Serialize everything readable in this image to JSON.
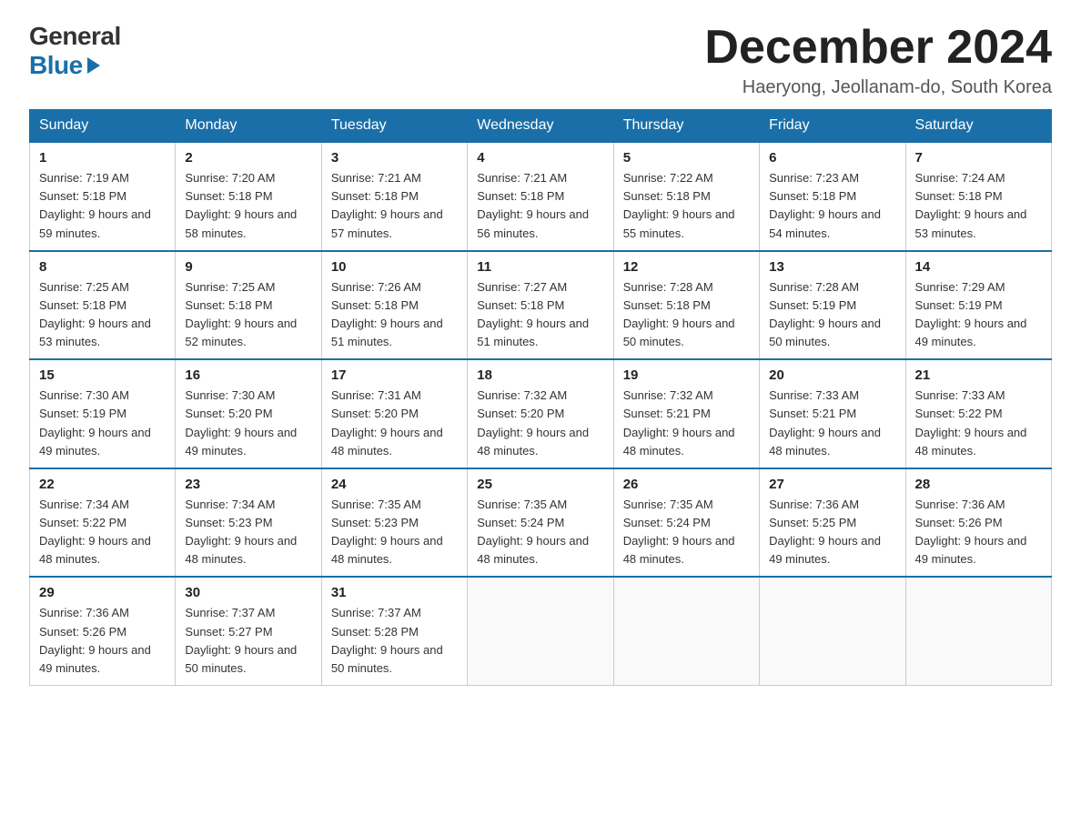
{
  "header": {
    "logo_line1": "General",
    "logo_line2": "Blue",
    "month_title": "December 2024",
    "location": "Haeryong, Jeollanam-do, South Korea"
  },
  "days_of_week": [
    "Sunday",
    "Monday",
    "Tuesday",
    "Wednesday",
    "Thursday",
    "Friday",
    "Saturday"
  ],
  "weeks": [
    [
      {
        "day": "1",
        "sunrise": "7:19 AM",
        "sunset": "5:18 PM",
        "daylight": "9 hours and 59 minutes."
      },
      {
        "day": "2",
        "sunrise": "7:20 AM",
        "sunset": "5:18 PM",
        "daylight": "9 hours and 58 minutes."
      },
      {
        "day": "3",
        "sunrise": "7:21 AM",
        "sunset": "5:18 PM",
        "daylight": "9 hours and 57 minutes."
      },
      {
        "day": "4",
        "sunrise": "7:21 AM",
        "sunset": "5:18 PM",
        "daylight": "9 hours and 56 minutes."
      },
      {
        "day": "5",
        "sunrise": "7:22 AM",
        "sunset": "5:18 PM",
        "daylight": "9 hours and 55 minutes."
      },
      {
        "day": "6",
        "sunrise": "7:23 AM",
        "sunset": "5:18 PM",
        "daylight": "9 hours and 54 minutes."
      },
      {
        "day": "7",
        "sunrise": "7:24 AM",
        "sunset": "5:18 PM",
        "daylight": "9 hours and 53 minutes."
      }
    ],
    [
      {
        "day": "8",
        "sunrise": "7:25 AM",
        "sunset": "5:18 PM",
        "daylight": "9 hours and 53 minutes."
      },
      {
        "day": "9",
        "sunrise": "7:25 AM",
        "sunset": "5:18 PM",
        "daylight": "9 hours and 52 minutes."
      },
      {
        "day": "10",
        "sunrise": "7:26 AM",
        "sunset": "5:18 PM",
        "daylight": "9 hours and 51 minutes."
      },
      {
        "day": "11",
        "sunrise": "7:27 AM",
        "sunset": "5:18 PM",
        "daylight": "9 hours and 51 minutes."
      },
      {
        "day": "12",
        "sunrise": "7:28 AM",
        "sunset": "5:18 PM",
        "daylight": "9 hours and 50 minutes."
      },
      {
        "day": "13",
        "sunrise": "7:28 AM",
        "sunset": "5:19 PM",
        "daylight": "9 hours and 50 minutes."
      },
      {
        "day": "14",
        "sunrise": "7:29 AM",
        "sunset": "5:19 PM",
        "daylight": "9 hours and 49 minutes."
      }
    ],
    [
      {
        "day": "15",
        "sunrise": "7:30 AM",
        "sunset": "5:19 PM",
        "daylight": "9 hours and 49 minutes."
      },
      {
        "day": "16",
        "sunrise": "7:30 AM",
        "sunset": "5:20 PM",
        "daylight": "9 hours and 49 minutes."
      },
      {
        "day": "17",
        "sunrise": "7:31 AM",
        "sunset": "5:20 PM",
        "daylight": "9 hours and 48 minutes."
      },
      {
        "day": "18",
        "sunrise": "7:32 AM",
        "sunset": "5:20 PM",
        "daylight": "9 hours and 48 minutes."
      },
      {
        "day": "19",
        "sunrise": "7:32 AM",
        "sunset": "5:21 PM",
        "daylight": "9 hours and 48 minutes."
      },
      {
        "day": "20",
        "sunrise": "7:33 AM",
        "sunset": "5:21 PM",
        "daylight": "9 hours and 48 minutes."
      },
      {
        "day": "21",
        "sunrise": "7:33 AM",
        "sunset": "5:22 PM",
        "daylight": "9 hours and 48 minutes."
      }
    ],
    [
      {
        "day": "22",
        "sunrise": "7:34 AM",
        "sunset": "5:22 PM",
        "daylight": "9 hours and 48 minutes."
      },
      {
        "day": "23",
        "sunrise": "7:34 AM",
        "sunset": "5:23 PM",
        "daylight": "9 hours and 48 minutes."
      },
      {
        "day": "24",
        "sunrise": "7:35 AM",
        "sunset": "5:23 PM",
        "daylight": "9 hours and 48 minutes."
      },
      {
        "day": "25",
        "sunrise": "7:35 AM",
        "sunset": "5:24 PM",
        "daylight": "9 hours and 48 minutes."
      },
      {
        "day": "26",
        "sunrise": "7:35 AM",
        "sunset": "5:24 PM",
        "daylight": "9 hours and 48 minutes."
      },
      {
        "day": "27",
        "sunrise": "7:36 AM",
        "sunset": "5:25 PM",
        "daylight": "9 hours and 49 minutes."
      },
      {
        "day": "28",
        "sunrise": "7:36 AM",
        "sunset": "5:26 PM",
        "daylight": "9 hours and 49 minutes."
      }
    ],
    [
      {
        "day": "29",
        "sunrise": "7:36 AM",
        "sunset": "5:26 PM",
        "daylight": "9 hours and 49 minutes."
      },
      {
        "day": "30",
        "sunrise": "7:37 AM",
        "sunset": "5:27 PM",
        "daylight": "9 hours and 50 minutes."
      },
      {
        "day": "31",
        "sunrise": "7:37 AM",
        "sunset": "5:28 PM",
        "daylight": "9 hours and 50 minutes."
      },
      null,
      null,
      null,
      null
    ]
  ]
}
